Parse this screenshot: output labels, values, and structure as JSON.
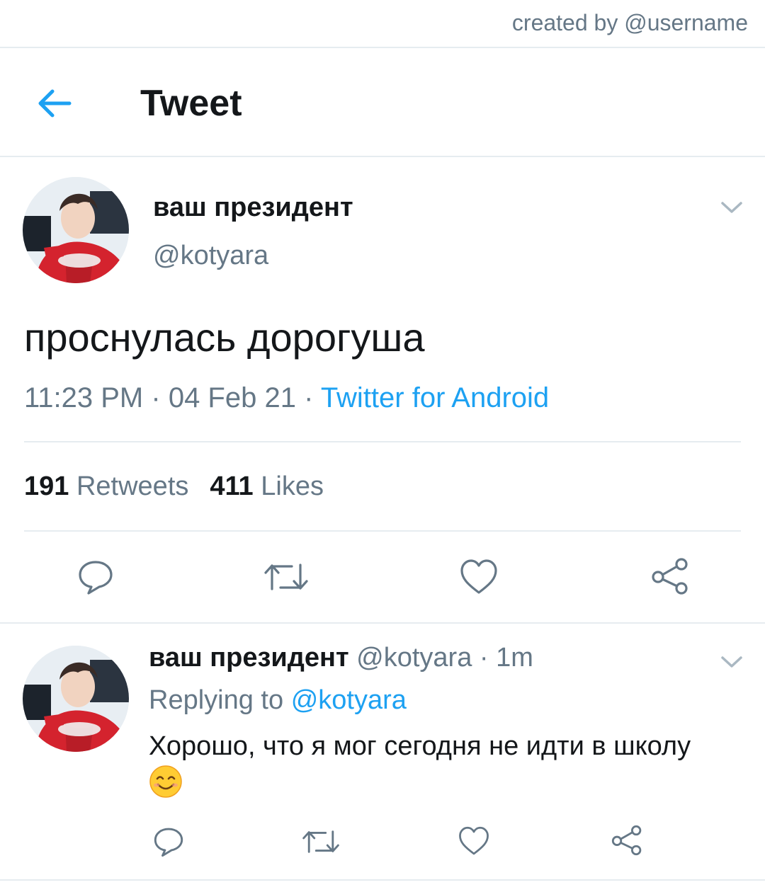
{
  "credit": "created by @username",
  "header": {
    "title": "Tweet"
  },
  "tweet": {
    "display_name": "ваш президент",
    "handle": "@kotyara",
    "text": "проснулась дорогуша",
    "time": "11:23 PM",
    "date": "04 Feb 21",
    "source": "Twitter for Android",
    "sep": "·",
    "retweet_count": "191",
    "retweet_label": "Retweets",
    "like_count": "411",
    "like_label": "Likes"
  },
  "reply": {
    "display_name": "ваш президент",
    "handle": "@kotyara",
    "time_ago": "1m",
    "sep": "·",
    "replying_prefix": "Replying to",
    "replying_to": "@kotyara",
    "text": "Хорошо, что я мог сегодня не идти в школу",
    "emoji": "smiling-face-icon"
  },
  "colors": {
    "accent": "#1da1f2",
    "muted": "#657786",
    "divider": "#e6ecf0"
  }
}
